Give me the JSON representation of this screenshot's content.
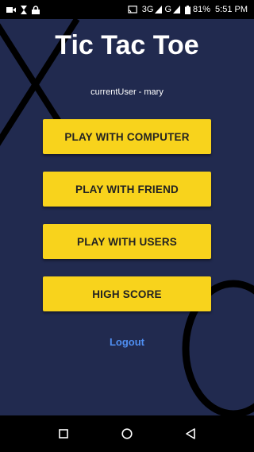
{
  "status_bar": {
    "network": "3G",
    "network_g": "G",
    "battery": "81%",
    "time": "5:51 PM",
    "icons_left": [
      "video-camera-icon",
      "hourglass-icon",
      "lock-icon"
    ],
    "icons_right": [
      "cast-icon",
      "signal-icon",
      "signal-icon",
      "battery-icon"
    ]
  },
  "app": {
    "title": "Tic Tac Toe",
    "current_user": "currentUser - mary"
  },
  "menu": {
    "play_computer": "PLAY WITH COMPUTER",
    "play_friend": "PLAY WITH FRIEND",
    "play_users": "PLAY WITH USERS",
    "high_score": "HIGH SCORE"
  },
  "logout": "Logout",
  "colors": {
    "background": "#212a4f",
    "button": "#f8d31c",
    "link": "#4f8ef1"
  },
  "nav_bar": {
    "icons": [
      "recents-square-icon",
      "home-circle-icon",
      "back-triangle-icon"
    ]
  }
}
